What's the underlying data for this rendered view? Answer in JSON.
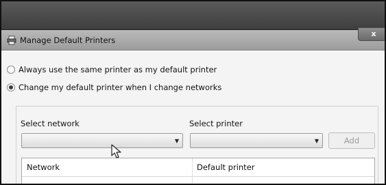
{
  "window": {
    "title": "Manage Default Printers",
    "close_label": "x"
  },
  "options": {
    "same_printer": "Always use the same printer as my default printer",
    "change_printer": "Change my default printer when I change networks",
    "selected": "change_printer"
  },
  "group": {
    "select_network_label": "Select network",
    "select_network_value": "",
    "select_printer_label": "Select printer",
    "select_printer_value": "",
    "add_label": "Add"
  },
  "table": {
    "columns": [
      "Network",
      "Default printer"
    ],
    "rows": []
  },
  "icons": {
    "window": "printer-icon",
    "combo": "chevron-down-icon",
    "pointer": "mouse-pointer-icon"
  }
}
